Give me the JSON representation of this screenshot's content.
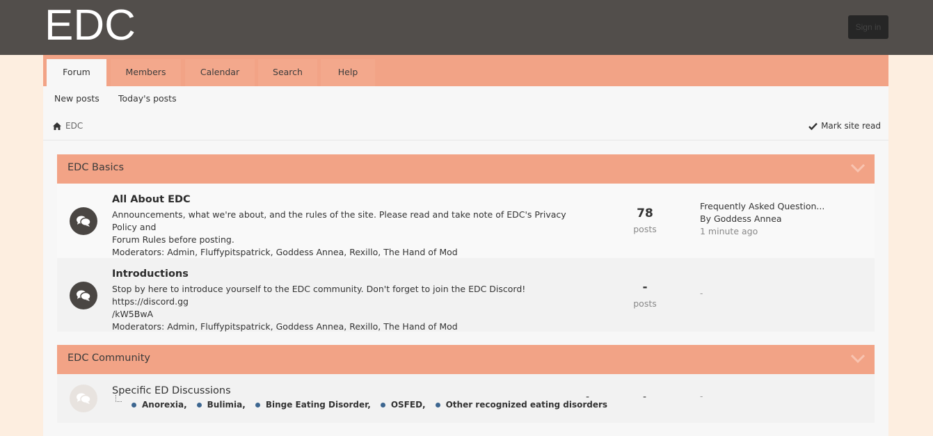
{
  "header": {
    "logo": "EDC",
    "signin_label": "Sign in"
  },
  "nav": {
    "tabs": [
      {
        "label": "Forum",
        "active": true
      },
      {
        "label": "Members"
      },
      {
        "label": "Calendar"
      },
      {
        "label": "Search"
      },
      {
        "label": "Help"
      }
    ]
  },
  "subnav": {
    "items": [
      "New posts",
      "Today's posts"
    ]
  },
  "breadcrumb": {
    "home_label": "EDC",
    "home_icon": "home-icon"
  },
  "mark_read": {
    "label": "Mark site read",
    "icon": "check-icon"
  },
  "categories": [
    {
      "title": "EDC Basics",
      "forums": [
        {
          "title": "All About EDC",
          "description_line1": "Announcements, what we're about, and the rules of the site. Please read and take note of EDC's Privacy Policy and",
          "description_line2": "Forum Rules before posting.",
          "moderators": "Moderators: Admin, Fluffypitspatrick, Goddess Annea, Rexillo, The Hand of Mod",
          "posts": "78",
          "posts_label": "posts",
          "last_post_title": "Frequently Asked Question...",
          "last_post_by": "By Goddess Annea",
          "last_post_time": "1 minute ago"
        },
        {
          "title": "Introductions",
          "description_line1": "Stop by here to introduce yourself to the EDC community. Don't forget to join the EDC Discord! https://discord.gg",
          "description_line2": "/kW5BwA",
          "moderators": "Moderators: Admin, Fluffypitspatrick, Goddess Annea, Rexillo, The Hand of Mod",
          "posts": "-",
          "posts_label": "posts",
          "last_post": "-"
        }
      ]
    },
    {
      "title": "EDC Community",
      "forums": [
        {
          "title": "Specific ED Discussions",
          "subforums": [
            "Anorexia,",
            "Bulimia,",
            "Binge Eating Disorder,",
            "OSFED,",
            "Other recognized eating disorders"
          ],
          "threads": "-",
          "posts": "-",
          "last_post": "-"
        }
      ]
    }
  ],
  "colors": {
    "topbar": "#524e4b",
    "accent": "#f2a386",
    "page_bg": "#fdeee0",
    "bullet": "#3d6690"
  }
}
